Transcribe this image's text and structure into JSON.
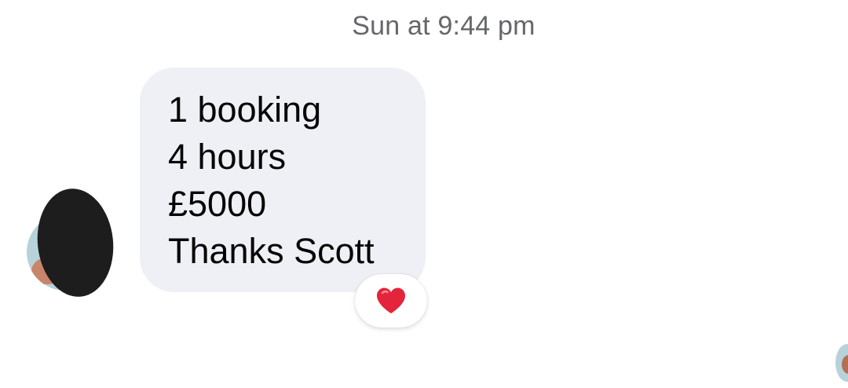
{
  "conversation": {
    "timestamp": "Sun at 9:44 pm",
    "message": {
      "lines": [
        "1 booking",
        "4 hours",
        "£5000",
        "Thanks Scott"
      ],
      "reaction": {
        "icon": "heart-icon",
        "color": "#e3243a"
      }
    },
    "sender": {
      "avatar_icon": "avatar-icon"
    },
    "read_receipt": {
      "icon": "seen-avatar-icon"
    }
  },
  "colors": {
    "bubble": "#eff0f5",
    "text": "#050505",
    "timestamp": "#65676b"
  }
}
